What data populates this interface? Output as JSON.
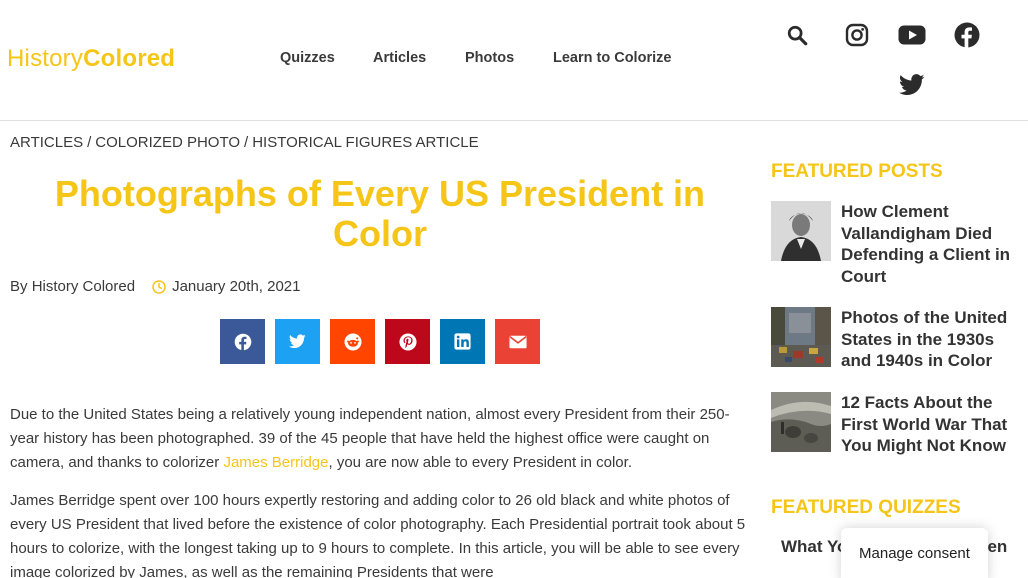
{
  "header": {
    "logo": {
      "part1": "History",
      "part2": "Colored"
    },
    "nav": [
      {
        "label": "Quizzes"
      },
      {
        "label": "Articles"
      },
      {
        "label": "Photos"
      },
      {
        "label": "Learn to Colorize"
      }
    ],
    "icons": [
      "search-icon",
      "instagram-icon",
      "youtube-icon",
      "facebook-icon",
      "twitter-icon"
    ]
  },
  "breadcrumb": {
    "items": [
      "Articles",
      "Colorized Photo",
      "Historical Figures Article"
    ],
    "separator": "/"
  },
  "article": {
    "title": "Photographs of Every US President in Color",
    "author_prefix": "By",
    "author": "History Colored",
    "date": "January 20th, 2021",
    "share": [
      {
        "name": "facebook",
        "color": "#3b5998"
      },
      {
        "name": "twitter",
        "color": "#1da1f2"
      },
      {
        "name": "reddit",
        "color": "#ff4500"
      },
      {
        "name": "pinterest",
        "color": "#bd081c"
      },
      {
        "name": "linkedin",
        "color": "#0077b5"
      },
      {
        "name": "email",
        "color": "#ea4335"
      }
    ],
    "p1_a": "Due to the United States being a relatively young independent nation, almost every President from their 250-year history has been photographed. 39 of the 45 people that have held the highest office were caught on camera, and thanks to colorizer ",
    "p1_link": "James Berridge",
    "p1_b": ", you are now able to every President in color.",
    "p2": "James Berridge spent over 100 hours expertly restoring and adding color to 26 old black and white photos of every US President that lived before the existence of color photography. Each Presidential portrait took about 5 hours to colorize, with the longest taking up to 9 hours to complete. In this article, you will be able to see every image colorized by James, as well as the remaining Presidents that were"
  },
  "sidebar": {
    "featured_posts_heading": "Featured Posts",
    "posts": [
      {
        "title": "How Clement Vallandigham Died Defending a Client in Court"
      },
      {
        "title": "Photos of the United States in the 1930s and 1940s in Color"
      },
      {
        "title": "12 Facts About the First World War That You Might Not Know"
      }
    ],
    "featured_quizzes_heading": "Featured Quizzes",
    "quiz_title_visible": "What Yo",
    "quiz_title_tail": "en"
  },
  "consent": {
    "label": "Manage consent"
  },
  "colors": {
    "brand": "#f5c518",
    "text": "#3a3a3a",
    "heading": "#333333"
  }
}
